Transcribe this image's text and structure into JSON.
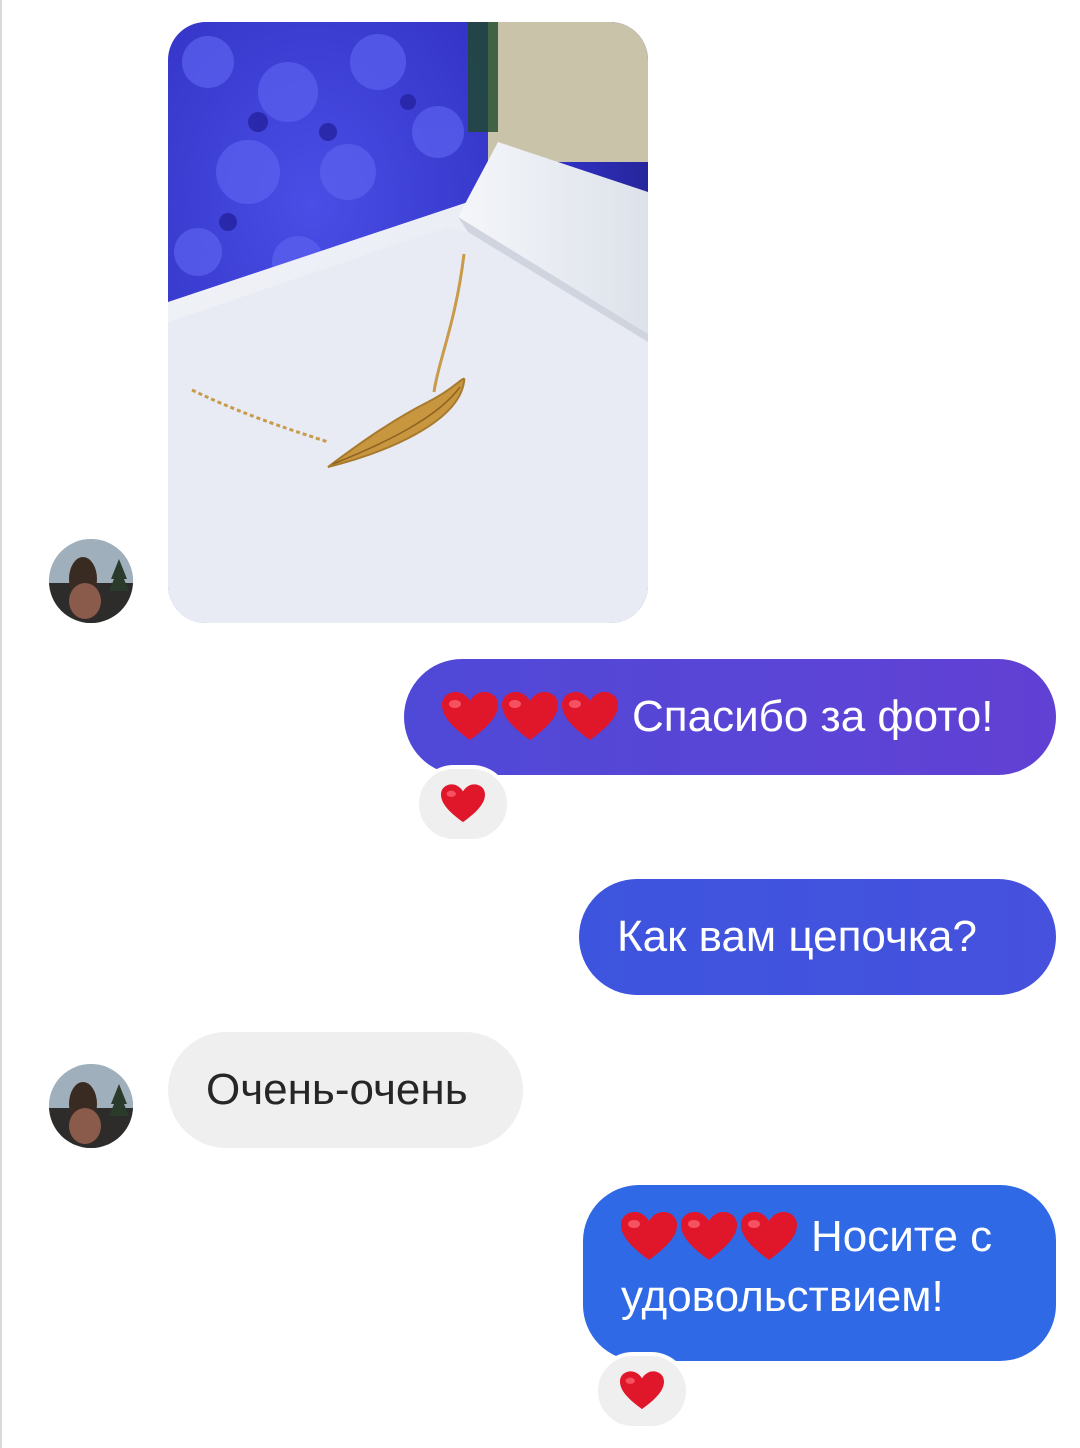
{
  "messages": [
    {
      "type": "image",
      "direction": "incoming",
      "alt": ""
    },
    {
      "type": "text",
      "direction": "outgoing",
      "emoji": [
        "❤️",
        "❤️",
        "❤️"
      ],
      "text": "Спасибо за фото!",
      "reaction": "❤️"
    },
    {
      "type": "text",
      "direction": "outgoing",
      "text": "Как вам цепочка?"
    },
    {
      "type": "text",
      "direction": "incoming",
      "text": "Очень-очень"
    },
    {
      "type": "text",
      "direction": "outgoing",
      "emoji": [
        "❤️",
        "❤️",
        "❤️"
      ],
      "text_line1": "Носите с",
      "text_line2": "удовольствием!",
      "reaction": "❤️"
    }
  ],
  "colors": {
    "heart": "#e0162b",
    "outgoing_purple": "#5b45d6",
    "outgoing_indigo": "#4651dd",
    "outgoing_blue": "#2f69e6",
    "incoming_bg": "#efefef"
  },
  "icons": {
    "reaction": "red-heart-icon",
    "avatar": "user-avatar"
  }
}
